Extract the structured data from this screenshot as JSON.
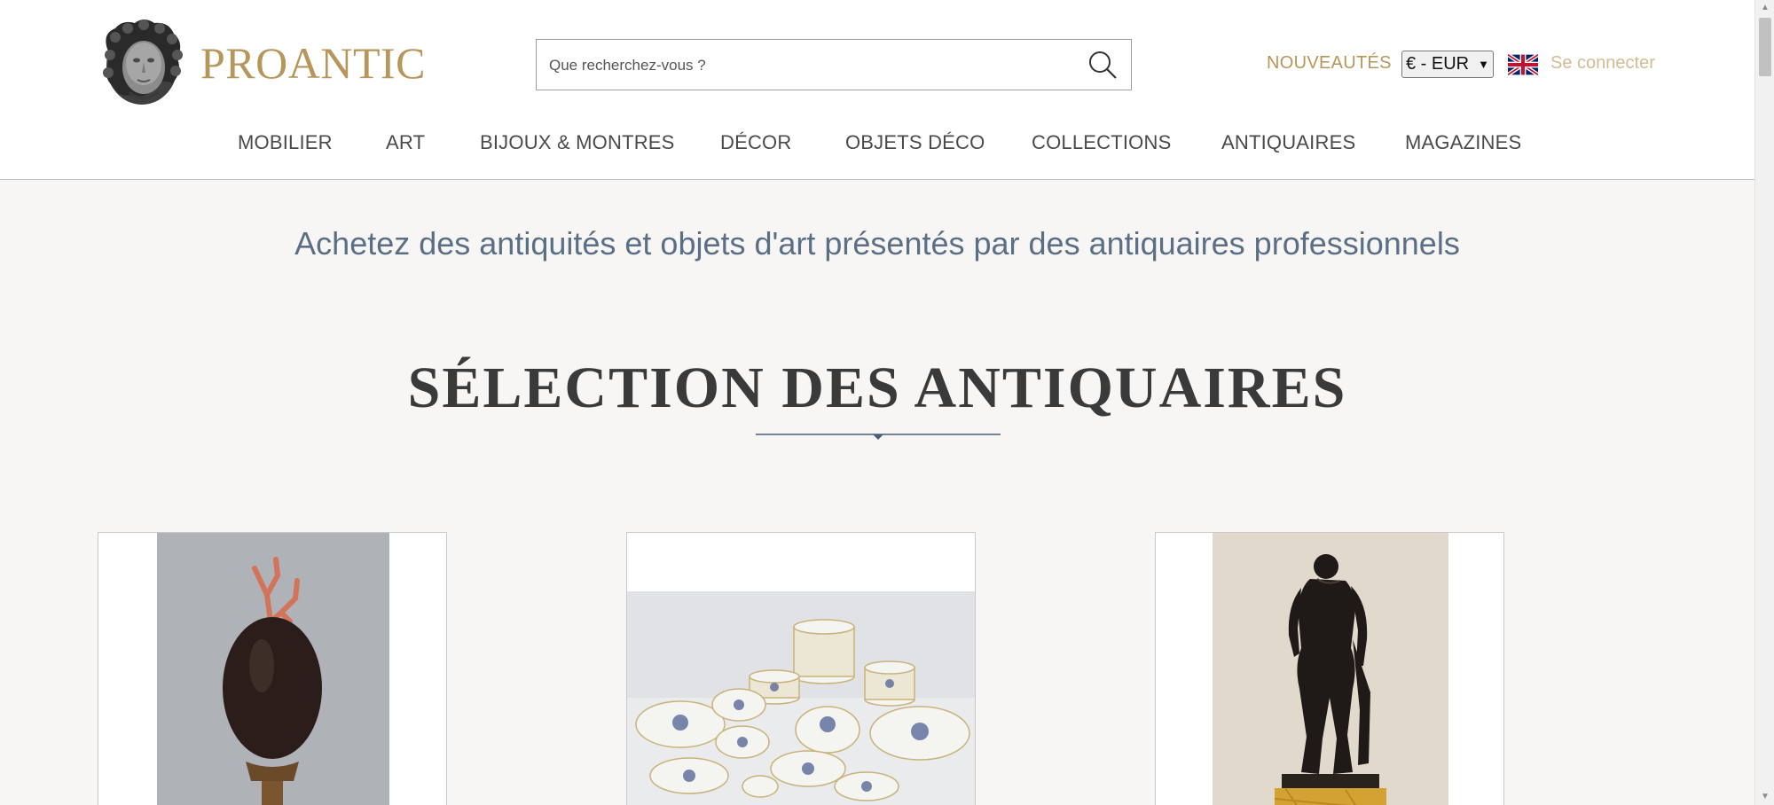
{
  "header": {
    "logo_text": "PROANTIC",
    "search": {
      "placeholder": "Que recherchez-vous ?",
      "value": ""
    },
    "new_items_link": "NOUVEAUTÉS",
    "currency": {
      "selected": "€ - EUR"
    },
    "language_flag": "uk-flag-icon",
    "login_link": "Se connecter"
  },
  "nav": {
    "items": [
      {
        "label": "MOBILIER"
      },
      {
        "label": "ART"
      },
      {
        "label": "BIJOUX & MONTRES"
      },
      {
        "label": "DÉCOR"
      },
      {
        "label": "OBJETS DÉCO"
      },
      {
        "label": "COLLECTIONS"
      },
      {
        "label": "ANTIQUAIRES"
      },
      {
        "label": "MAGAZINES"
      }
    ]
  },
  "main": {
    "tagline": "Achetez des antiquités et objets d'art présentés par des antiquaires professionnels",
    "section_title": "SÉLECTION DES ANTIQUAIRES",
    "products": [
      {
        "image": "coral-ostrich-egg-image"
      },
      {
        "image": "porcelain-dinner-service-image"
      },
      {
        "image": "bronze-hercules-statue-image"
      }
    ]
  },
  "colors": {
    "brand_gold": "#b7965c",
    "login_gold_light": "#d3bc94",
    "tagline_blue": "#5a6f86",
    "page_background": "#f7f6f4"
  }
}
